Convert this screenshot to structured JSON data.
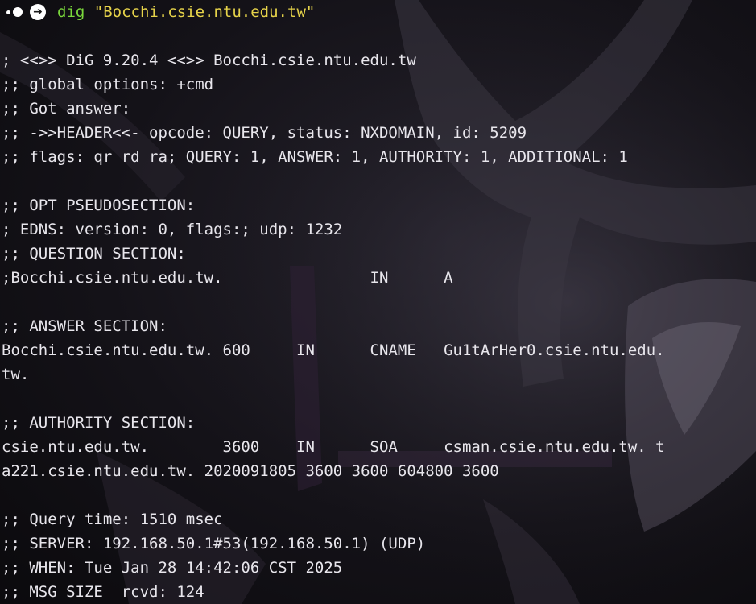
{
  "prompt": {
    "command": "dig",
    "argument": "\"Bocchi.csie.ntu.edu.tw\""
  },
  "output": [
    "",
    "; <<>> DiG 9.20.4 <<>> Bocchi.csie.ntu.edu.tw",
    ";; global options: +cmd",
    ";; Got answer:",
    ";; ->>HEADER<<- opcode: QUERY, status: NXDOMAIN, id: 5209",
    ";; flags: qr rd ra; QUERY: 1, ANSWER: 1, AUTHORITY: 1, ADDITIONAL: 1",
    "",
    ";; OPT PSEUDOSECTION:",
    "; EDNS: version: 0, flags:; udp: 1232",
    ";; QUESTION SECTION:",
    ";Bocchi.csie.ntu.edu.tw.                IN      A",
    "",
    ";; ANSWER SECTION:",
    "Bocchi.csie.ntu.edu.tw. 600     IN      CNAME   Gu1tArHer0.csie.ntu.edu.",
    "tw.",
    "",
    ";; AUTHORITY SECTION:",
    "csie.ntu.edu.tw.        3600    IN      SOA     csman.csie.ntu.edu.tw. t",
    "a221.csie.ntu.edu.tw. 2020091805 3600 3600 604800 3600",
    "",
    ";; Query time: 1510 msec",
    ";; SERVER: 192.168.50.1#53(192.168.50.1) (UDP)",
    ";; WHEN: Tue Jan 28 14:42:06 CST 2025",
    ";; MSG SIZE  rcvd: 124"
  ]
}
